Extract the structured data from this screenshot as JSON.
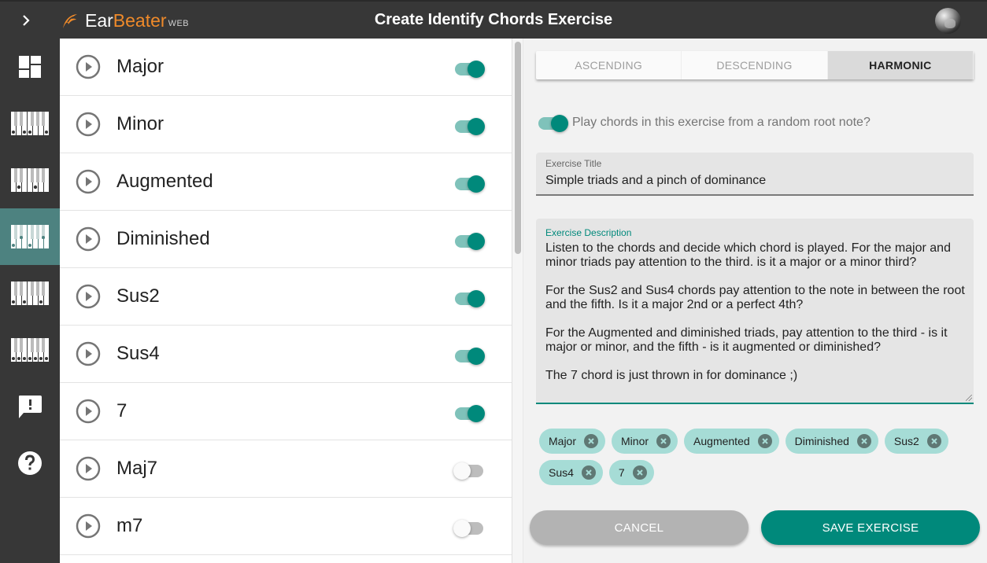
{
  "app": {
    "logo_ear": "Ear",
    "logo_beater": "Beater",
    "logo_suffix": "WEB",
    "page_title": "Create Identify Chords Exercise",
    "brand_color": "#ef8a2a",
    "accent_color": "#00897b"
  },
  "sidebar": {
    "items": [
      {
        "icon": "dashboard-icon",
        "active": false
      },
      {
        "icon": "piano-keys-icon",
        "active": false
      },
      {
        "icon": "piano-keys-icon",
        "active": false
      },
      {
        "icon": "piano-keys-icon",
        "active": true
      },
      {
        "icon": "piano-keys-icon",
        "active": false
      },
      {
        "icon": "piano-keys-icon",
        "active": false
      },
      {
        "icon": "feedback-icon",
        "active": false
      },
      {
        "icon": "help-icon",
        "active": false
      }
    ]
  },
  "chords": [
    {
      "name": "Major",
      "enabled": true
    },
    {
      "name": "Minor",
      "enabled": true
    },
    {
      "name": "Augmented",
      "enabled": true
    },
    {
      "name": "Diminished",
      "enabled": true
    },
    {
      "name": "Sus2",
      "enabled": true
    },
    {
      "name": "Sus4",
      "enabled": true
    },
    {
      "name": "7",
      "enabled": true
    },
    {
      "name": "Maj7",
      "enabled": false
    },
    {
      "name": "m7",
      "enabled": false
    }
  ],
  "tabs": [
    {
      "label": "ASCENDING",
      "active": false
    },
    {
      "label": "DESCENDING",
      "active": false
    },
    {
      "label": "HARMONIC",
      "active": true
    }
  ],
  "random_root": {
    "label": "Play chords in this exercise from a random root note?",
    "enabled": true
  },
  "form": {
    "title_label": "Exercise Title",
    "title_value": "Simple triads and a pinch of dominance",
    "description_label": "Exercise Description",
    "description_value": "Listen to the chords and decide which chord is played. For the major and minor triads pay attention to the third. is it a major or a minor third?\n\nFor the Sus2 and Sus4 chords pay attention to the note in between the root and the fifth. Is it a major 2nd or a perfect 4th?\n\nFor the Augmented and diminished triads, pay attention to the third - is it major or minor, and the fifth - is it augmented or diminished?\n\nThe 7 chord is just thrown in for dominance ;)"
  },
  "selected_chips": [
    "Major",
    "Minor",
    "Augmented",
    "Diminished",
    "Sus2",
    "Sus4",
    "7"
  ],
  "buttons": {
    "cancel": "CANCEL",
    "save": "SAVE EXERCISE"
  }
}
